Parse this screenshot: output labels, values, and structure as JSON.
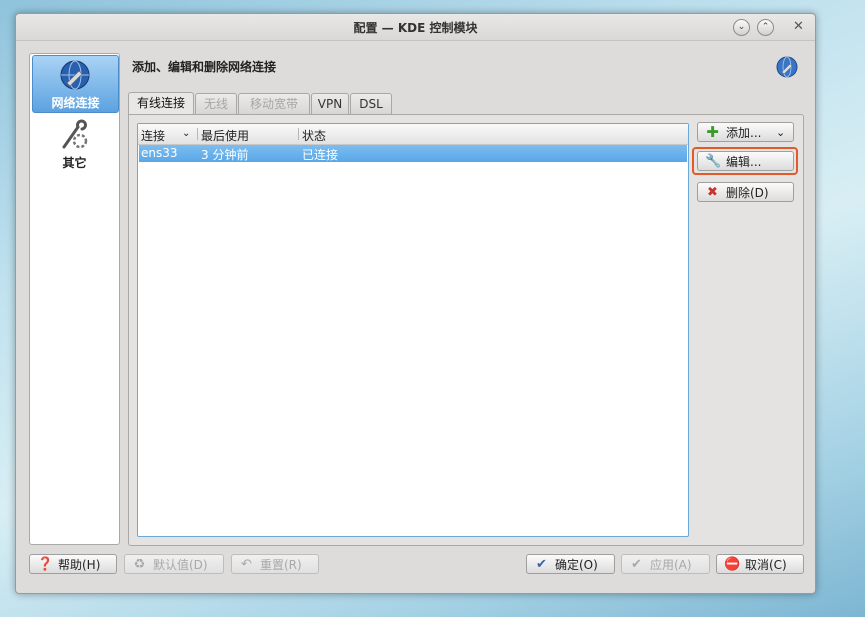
{
  "window": {
    "title": "配置 — KDE 控制模块"
  },
  "sidebar": {
    "items": [
      {
        "label": "网络连接",
        "icon": "network-globe-icon",
        "active": true
      },
      {
        "label": "其它",
        "icon": "wrench-gear-icon",
        "active": false
      }
    ]
  },
  "main": {
    "heading": "添加、编辑和删除网络连接",
    "tabs": [
      {
        "label": "有线连接",
        "active": true,
        "disabled": false
      },
      {
        "label": "无线",
        "active": false,
        "disabled": true
      },
      {
        "label": "移动宽带",
        "active": false,
        "disabled": true
      },
      {
        "label": "VPN",
        "active": false,
        "disabled": false
      },
      {
        "label": "DSL",
        "active": false,
        "disabled": false
      }
    ],
    "list": {
      "columns": [
        "连接",
        "最后使用",
        "状态"
      ],
      "rows": [
        {
          "name": "ens33",
          "last_used": "3 分钟前",
          "status": "已连接"
        }
      ]
    },
    "actions": {
      "add": "添加...",
      "edit": "编辑...",
      "delete": "删除(D)"
    }
  },
  "footer": {
    "help": "帮助(H)",
    "defaults": "默认值(D)",
    "reset": "重置(R)",
    "ok": "确定(O)",
    "apply": "应用(A)",
    "cancel": "取消(C)"
  },
  "colors": {
    "accent": "#5ca2e0",
    "highlight": "#e05a2a"
  }
}
